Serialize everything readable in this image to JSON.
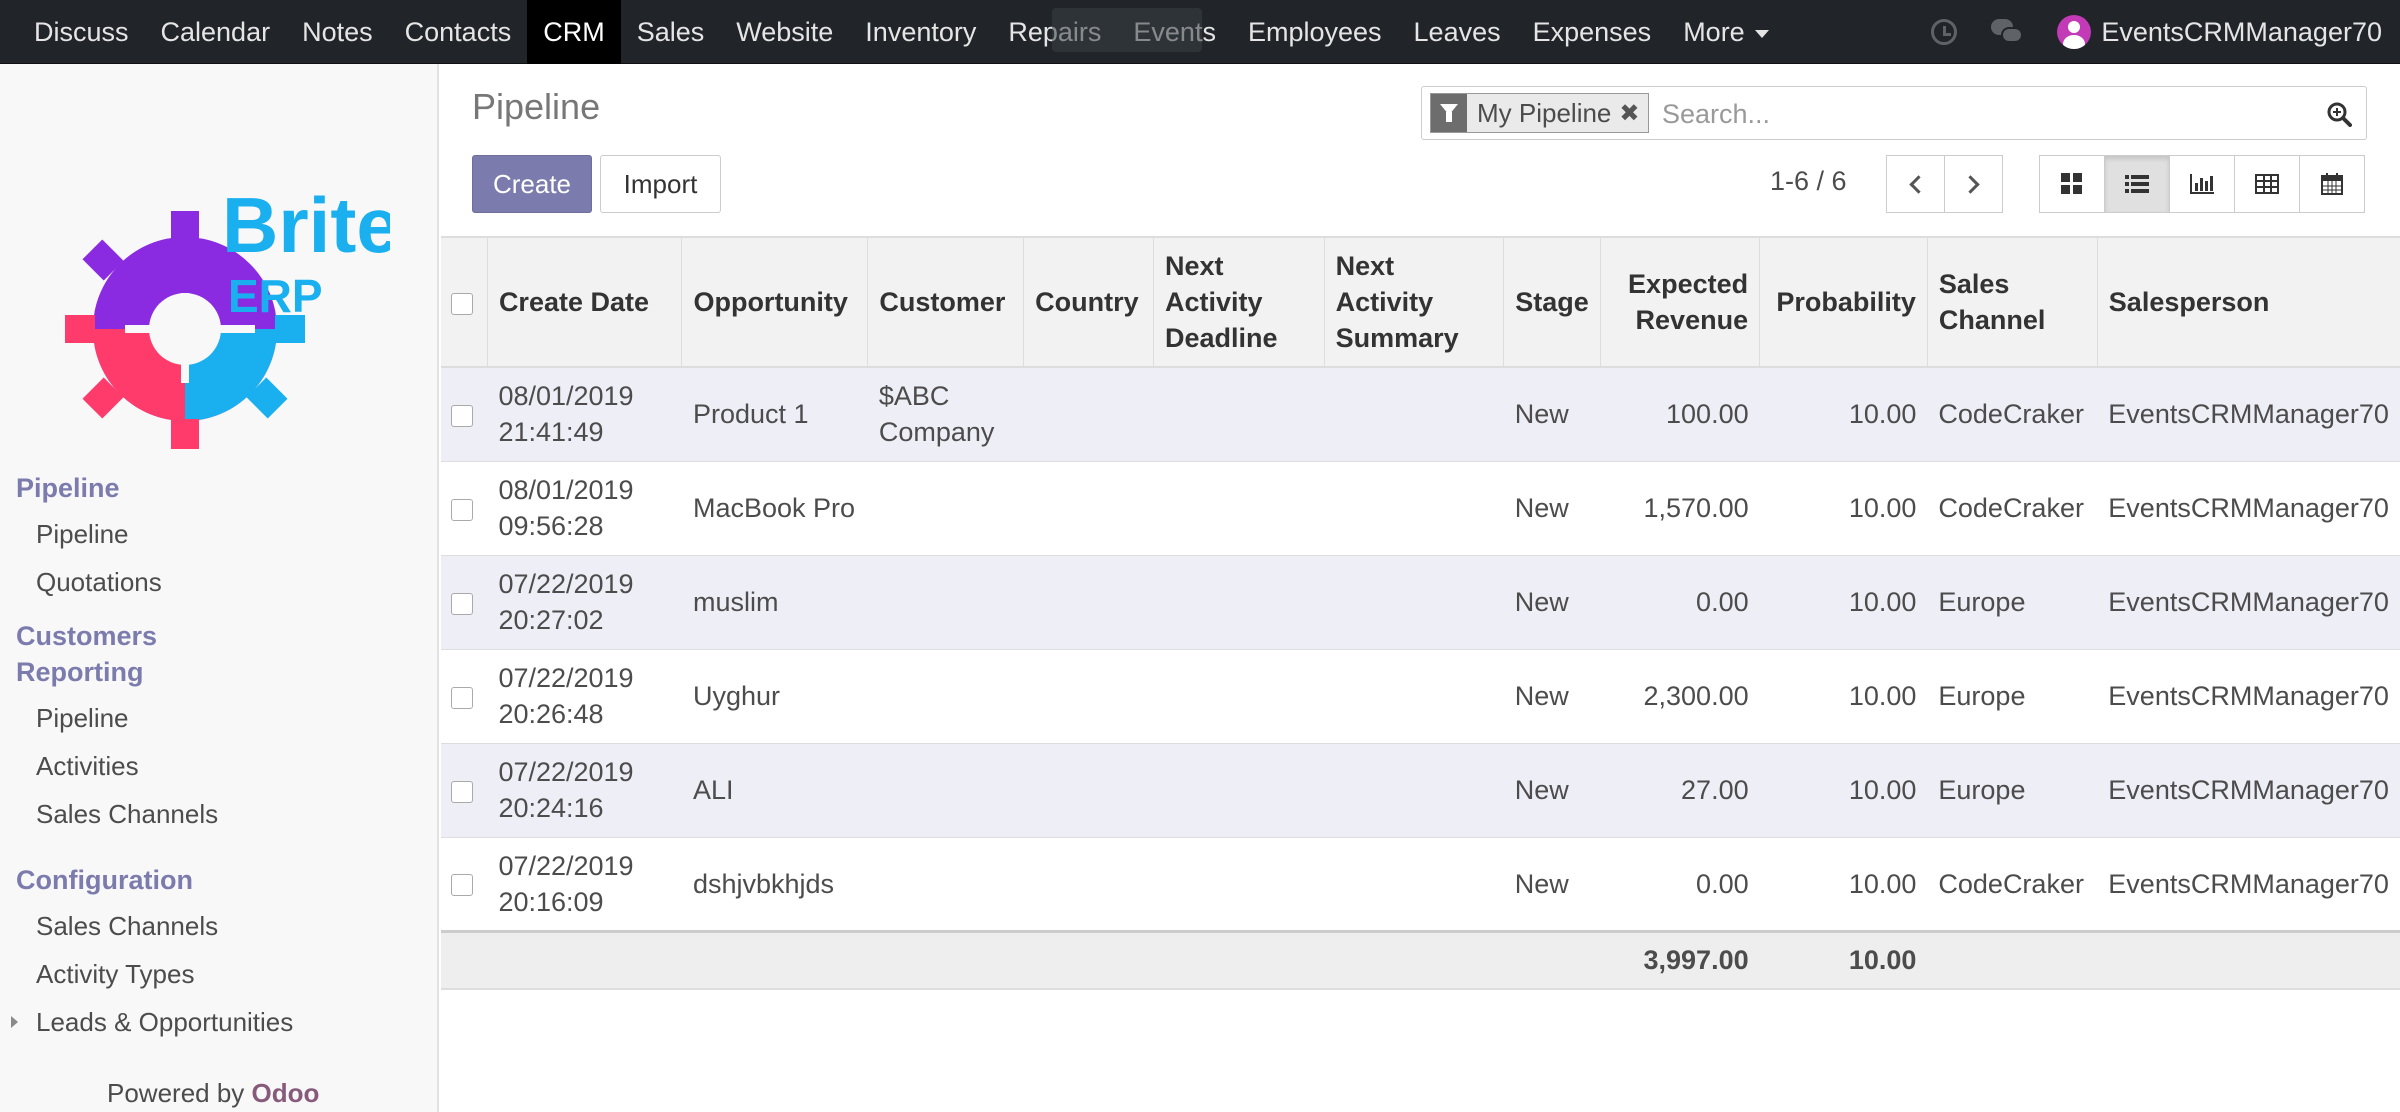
{
  "topnav": {
    "items": [
      {
        "label": "Discuss",
        "active": false
      },
      {
        "label": "Calendar",
        "active": false
      },
      {
        "label": "Notes",
        "active": false
      },
      {
        "label": "Contacts",
        "active": false
      },
      {
        "label": "CRM",
        "active": true
      },
      {
        "label": "Sales",
        "active": false
      },
      {
        "label": "Website",
        "active": false
      },
      {
        "label": "Inventory",
        "active": false
      },
      {
        "label": "Repairs",
        "active": false
      },
      {
        "label": "Events",
        "active": false
      },
      {
        "label": "Employees",
        "active": false
      },
      {
        "label": "Leaves",
        "active": false
      },
      {
        "label": "Expenses",
        "active": false
      }
    ],
    "more_label": "More",
    "icons": [
      "clock-icon",
      "chat-icon",
      "avatar"
    ],
    "username": "EventsCRMManager70"
  },
  "sidebar": {
    "sections": [
      {
        "title": "Pipeline",
        "items": [
          "Pipeline",
          "Quotations"
        ]
      },
      {
        "title": "Customers Reporting",
        "items": [
          "Pipeline",
          "Activities",
          "Sales Channels"
        ]
      },
      {
        "title": "Configuration",
        "items": [
          "Sales Channels",
          "Activity Types",
          "Leads & Opportunities"
        ]
      }
    ],
    "powered_prefix": "Powered by",
    "powered_brand": "Odoo",
    "logo_text_1": "Brite",
    "logo_text_2": "ERP"
  },
  "control_panel": {
    "breadcrumb": "Pipeline",
    "facet_label": "My Pipeline",
    "facet_remove": "✖",
    "search_placeholder": "Search...",
    "create_label": "Create",
    "import_label": "Import",
    "pager_value": "1-6 / 6",
    "views": [
      "kanban",
      "list",
      "graph",
      "pivot",
      "calendar"
    ],
    "active_view": "list"
  },
  "table": {
    "columns": [
      {
        "label": "Create Date",
        "num": false
      },
      {
        "label": "Opportunity",
        "num": false
      },
      {
        "label": "Customer",
        "num": false
      },
      {
        "label": "Country",
        "num": false
      },
      {
        "label": "Next Activity Deadline",
        "num": false
      },
      {
        "label": "Next Activity Summary",
        "num": false
      },
      {
        "label": "Stage",
        "num": false
      },
      {
        "label": "Expected Revenue",
        "num": true
      },
      {
        "label": "Probability",
        "num": true
      },
      {
        "label": "Sales Channel",
        "num": false
      },
      {
        "label": "Salesperson",
        "num": false
      }
    ],
    "rows": [
      {
        "date": "08/01/2019",
        "time": "21:41:49",
        "opportunity": "Product 1",
        "customer": "$ABC Company",
        "country": "",
        "deadline": "",
        "summary": "",
        "stage": "New",
        "revenue": "100.00",
        "probability": "10.00",
        "channel": "CodeCraker",
        "salesperson": "EventsCRMManager70"
      },
      {
        "date": "08/01/2019",
        "time": "09:56:28",
        "opportunity": "MacBook Pro",
        "customer": "",
        "country": "",
        "deadline": "",
        "summary": "",
        "stage": "New",
        "revenue": "1,570.00",
        "probability": "10.00",
        "channel": "CodeCraker",
        "salesperson": "EventsCRMManager70"
      },
      {
        "date": "07/22/2019",
        "time": "20:27:02",
        "opportunity": "muslim",
        "customer": "",
        "country": "",
        "deadline": "",
        "summary": "",
        "stage": "New",
        "revenue": "0.00",
        "probability": "10.00",
        "channel": "Europe",
        "salesperson": "EventsCRMManager70"
      },
      {
        "date": "07/22/2019",
        "time": "20:26:48",
        "opportunity": "Uyghur",
        "customer": "",
        "country": "",
        "deadline": "",
        "summary": "",
        "stage": "New",
        "revenue": "2,300.00",
        "probability": "10.00",
        "channel": "Europe",
        "salesperson": "EventsCRMManager70"
      },
      {
        "date": "07/22/2019",
        "time": "20:24:16",
        "opportunity": "ALI",
        "customer": "",
        "country": "",
        "deadline": "",
        "summary": "",
        "stage": "New",
        "revenue": "27.00",
        "probability": "10.00",
        "channel": "Europe",
        "salesperson": "EventsCRMManager70"
      },
      {
        "date": "07/22/2019",
        "time": "20:16:09",
        "opportunity": "dshjvbkhjds",
        "customer": "",
        "country": "",
        "deadline": "",
        "summary": "",
        "stage": "New",
        "revenue": "0.00",
        "probability": "10.00",
        "channel": "CodeCraker",
        "salesperson": "EventsCRMManager70"
      }
    ],
    "totals": {
      "revenue": "3,997.00",
      "probability": "10.00"
    }
  },
  "colors": {
    "topbar": "#212529",
    "primary": "#7c7bad",
    "brand": "#875a7b",
    "logo_purple": "#8a2be2",
    "logo_pink": "#ff3b6b",
    "logo_blue": "#1ab0f0"
  }
}
